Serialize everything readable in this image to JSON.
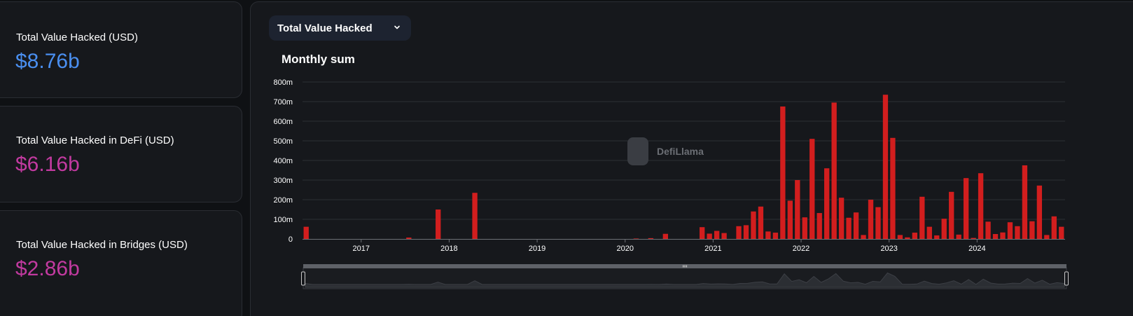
{
  "stats": [
    {
      "label": "Total Value Hacked (USD)",
      "value": "$8.76b",
      "color": "#4a8ff0"
    },
    {
      "label": "Total Value Hacked in DeFi (USD)",
      "value": "$6.16b",
      "color": "#c23aa0"
    },
    {
      "label": "Total Value Hacked in Bridges (USD)",
      "value": "$2.86b",
      "color": "#c23aa0"
    }
  ],
  "chart_panel": {
    "dropdown_label": "Total Value Hacked",
    "dropdown_icon": "chevron-down-icon",
    "watermark": "DefiLlama"
  },
  "chart_data": {
    "type": "bar",
    "title": "Monthly sum",
    "xlabel": "",
    "ylabel": "",
    "bar_color": "#d21e1e",
    "grid": true,
    "ylim": [
      0,
      800
    ],
    "y_unit": "m (millions USD)",
    "y_ticks": [
      "0",
      "100m",
      "200m",
      "300m",
      "400m",
      "500m",
      "600m",
      "700m",
      "800m"
    ],
    "x_ticks": [
      "2017",
      "2018",
      "2019",
      "2020",
      "2021",
      "2022",
      "2023",
      "2024"
    ],
    "x": [
      "2016-05",
      "2016-06",
      "2016-07",
      "2016-08",
      "2016-09",
      "2016-10",
      "2016-11",
      "2016-12",
      "2017-01",
      "2017-02",
      "2017-03",
      "2017-04",
      "2017-05",
      "2017-06",
      "2017-07",
      "2017-08",
      "2017-09",
      "2017-10",
      "2017-11",
      "2017-12",
      "2018-01",
      "2018-02",
      "2018-03",
      "2018-04",
      "2018-05",
      "2018-06",
      "2018-07",
      "2018-08",
      "2018-09",
      "2018-10",
      "2018-11",
      "2018-12",
      "2019-01",
      "2019-02",
      "2019-03",
      "2019-04",
      "2019-05",
      "2019-06",
      "2019-07",
      "2019-08",
      "2019-09",
      "2019-10",
      "2019-11",
      "2019-12",
      "2020-01",
      "2020-02",
      "2020-03",
      "2020-04",
      "2020-05",
      "2020-06",
      "2020-07",
      "2020-08",
      "2020-09",
      "2020-10",
      "2020-11",
      "2020-12",
      "2021-01",
      "2021-02",
      "2021-03",
      "2021-04",
      "2021-05",
      "2021-06",
      "2021-07",
      "2021-08",
      "2021-09",
      "2021-10",
      "2021-11",
      "2021-12",
      "2022-01",
      "2022-02",
      "2022-03",
      "2022-04",
      "2022-05",
      "2022-06",
      "2022-07",
      "2022-08",
      "2022-09",
      "2022-10",
      "2022-11",
      "2022-12",
      "2023-01",
      "2023-02",
      "2023-03",
      "2023-04",
      "2023-05",
      "2023-06",
      "2023-07",
      "2023-08",
      "2023-09",
      "2023-10",
      "2023-11",
      "2023-12",
      "2024-01",
      "2024-02",
      "2024-03",
      "2024-04",
      "2024-05",
      "2024-06",
      "2024-07",
      "2024-08",
      "2024-09",
      "2024-10"
    ],
    "values": [
      62,
      0,
      0,
      0,
      0,
      0,
      0,
      0,
      0,
      0,
      0,
      0,
      0,
      0,
      7,
      0,
      0,
      0,
      150,
      0,
      0,
      0,
      0,
      235,
      0,
      0,
      0,
      0,
      0,
      0,
      0,
      0,
      0,
      0,
      0,
      0,
      0,
      0,
      0,
      0,
      0,
      0,
      0,
      0,
      0,
      2,
      0,
      4,
      0,
      26,
      0,
      0,
      0,
      0,
      60,
      27,
      41,
      30,
      0,
      65,
      70,
      140,
      165,
      38,
      32,
      675,
      195,
      300,
      110,
      510,
      132,
      360,
      695,
      210,
      108,
      135,
      20,
      200,
      162,
      735,
      515,
      20,
      8,
      32,
      215,
      62,
      18,
      103,
      240,
      22,
      310,
      5,
      335,
      88,
      25,
      33,
      85,
      65,
      375,
      90,
      272,
      20,
      115,
      62
    ]
  }
}
